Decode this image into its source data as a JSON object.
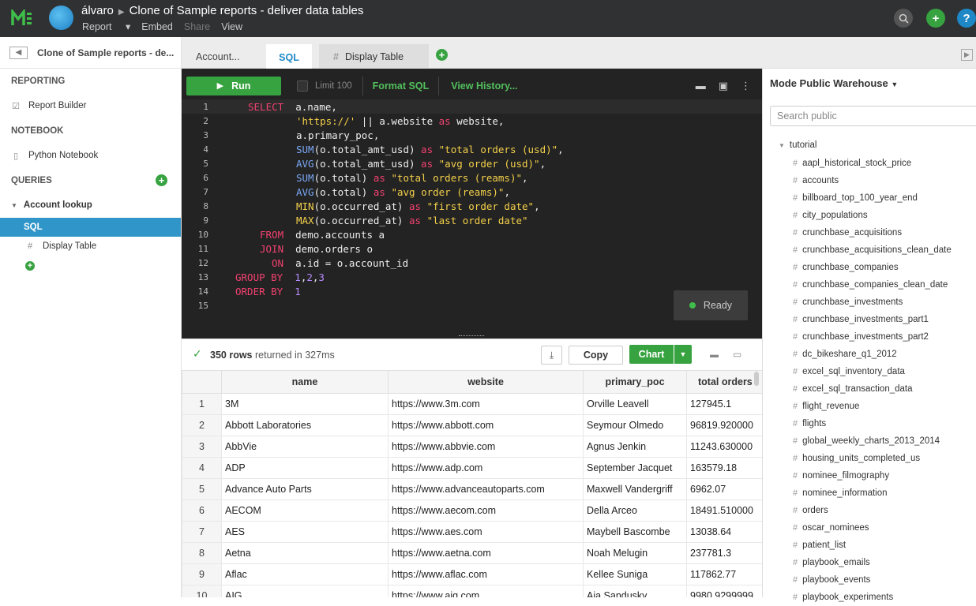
{
  "topbar": {
    "user": "álvaro",
    "report_title": "Clone of Sample reports - deliver data tables",
    "menu": [
      "Report",
      "Embed",
      "Share",
      "View"
    ]
  },
  "sidebar": {
    "report_name": "Clone of Sample reports - de...",
    "reporting_label": "REPORTING",
    "report_builder": "Report Builder",
    "notebook_label": "NOTEBOOK",
    "python_notebook": "Python Notebook",
    "queries_label": "QUERIES",
    "query_name": "Account lookup",
    "sql_item": "SQL",
    "display_table_item": "Display Table"
  },
  "tabs": {
    "account": "Account...",
    "sql": "SQL",
    "display_table": "Display Table"
  },
  "editor": {
    "run_label": "Run",
    "limit_label": "Limit 100",
    "format_label": "Format SQL",
    "history_label": "View History...",
    "status": "Ready"
  },
  "results": {
    "rows_count": "350 rows",
    "rows_suffix": "returned in 327ms",
    "copy_label": "Copy",
    "chart_label": "Chart",
    "columns": [
      "name",
      "website",
      "primary_poc",
      "total orders"
    ],
    "rows": [
      [
        "1",
        "3M",
        "https://www.3m.com",
        "Orville Leavell",
        "127945.1"
      ],
      [
        "2",
        "Abbott Laboratories",
        "https://www.abbott.com",
        "Seymour Olmedo",
        "96819.920000"
      ],
      [
        "3",
        "AbbVie",
        "https://www.abbvie.com",
        "Agnus Jenkin",
        "11243.630000"
      ],
      [
        "4",
        "ADP",
        "https://www.adp.com",
        "September Jacquet",
        "163579.18"
      ],
      [
        "5",
        "Advance Auto Parts",
        "https://www.advanceautoparts.com",
        "Maxwell Vandergriff",
        "6962.07"
      ],
      [
        "6",
        "AECOM",
        "https://www.aecom.com",
        "Della Arceo",
        "18491.510000"
      ],
      [
        "7",
        "AES",
        "https://www.aes.com",
        "Maybell Bascombe",
        "13038.64"
      ],
      [
        "8",
        "Aetna",
        "https://www.aetna.com",
        "Noah Melugin",
        "237781.3"
      ],
      [
        "9",
        "Aflac",
        "https://www.aflac.com",
        "Kellee Suniga",
        "117862.77"
      ],
      [
        "10",
        "AIG",
        "https://www.aig.com",
        "Aja Sandusky",
        "9980.9299999"
      ]
    ]
  },
  "schema": {
    "warehouse": "Mode Public Warehouse",
    "search_placeholder": "Search public",
    "root": "tutorial",
    "tables": [
      "aapl_historical_stock_price",
      "accounts",
      "billboard_top_100_year_end",
      "city_populations",
      "crunchbase_acquisitions",
      "crunchbase_acquisitions_clean_date",
      "crunchbase_companies",
      "crunchbase_companies_clean_date",
      "crunchbase_investments",
      "crunchbase_investments_part1",
      "crunchbase_investments_part2",
      "dc_bikeshare_q1_2012",
      "excel_sql_inventory_data",
      "excel_sql_transaction_data",
      "flight_revenue",
      "flights",
      "global_weekly_charts_2013_2014",
      "housing_units_completed_us",
      "nominee_filmography",
      "nominee_information",
      "orders",
      "oscar_nominees",
      "patient_list",
      "playbook_emails",
      "playbook_events",
      "playbook_experiments"
    ]
  }
}
